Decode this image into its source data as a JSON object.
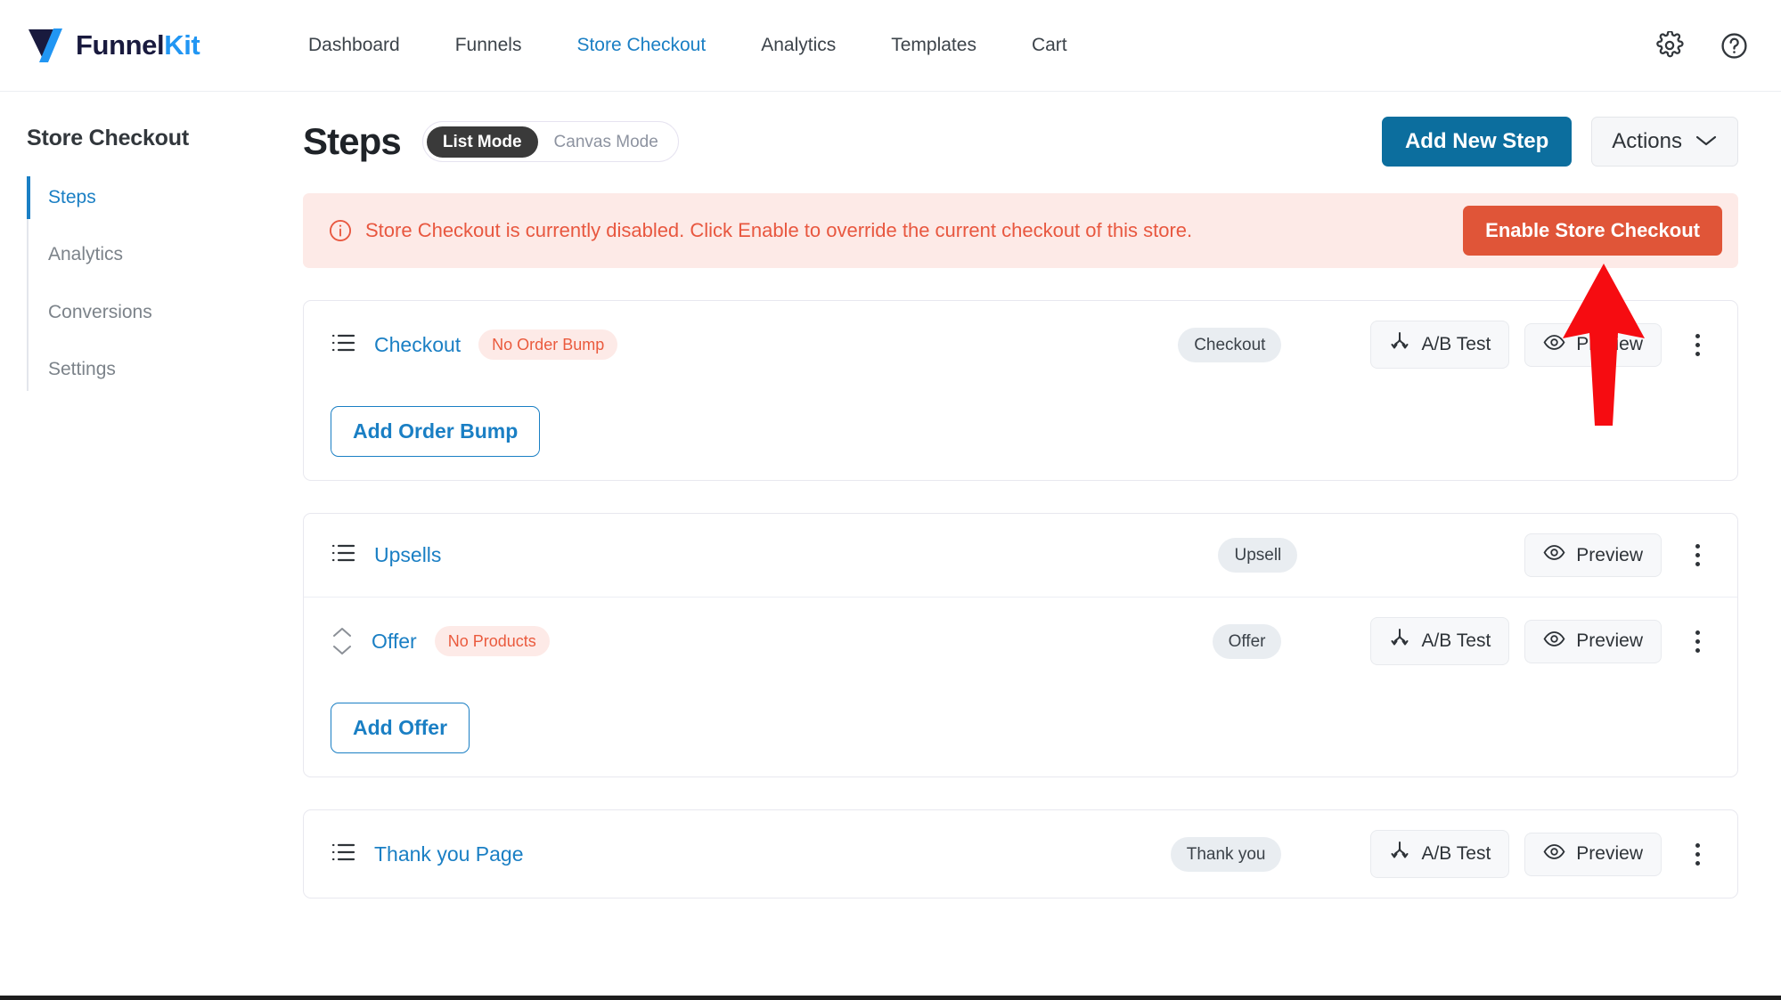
{
  "header": {
    "logo": {
      "icon": "funnelkit-logo-icon",
      "text_primary": "Funnel",
      "text_accent": "Kit"
    },
    "nav": [
      {
        "label": "Dashboard",
        "active": false
      },
      {
        "label": "Funnels",
        "active": false
      },
      {
        "label": "Store Checkout",
        "active": true
      },
      {
        "label": "Analytics",
        "active": false
      },
      {
        "label": "Templates",
        "active": false
      },
      {
        "label": "Cart",
        "active": false
      }
    ],
    "settings_icon": "gear-icon",
    "help_icon": "question-circle-icon"
  },
  "sidebar": {
    "title": "Store Checkout",
    "items": [
      {
        "label": "Steps",
        "active": true
      },
      {
        "label": "Analytics",
        "active": false
      },
      {
        "label": "Conversions",
        "active": false
      },
      {
        "label": "Settings",
        "active": false
      }
    ]
  },
  "main": {
    "page_title": "Steps",
    "mode_toggle": {
      "active": "List Mode",
      "inactive": "Canvas Mode"
    },
    "add_new_step_label": "Add New Step",
    "actions_label": "Actions",
    "notice": {
      "icon": "info-circle-icon",
      "text": "Store Checkout is currently disabled. Click Enable to override the current checkout of this store.",
      "button_label": "Enable Store Checkout"
    },
    "buttons": {
      "ab_test": "A/B Test",
      "preview": "Preview"
    },
    "cards": [
      {
        "rows": [
          {
            "icon": "list-icon",
            "name": "Checkout",
            "badge_warn": "No Order Bump",
            "badge_type": "Checkout",
            "has_ab_test": true,
            "has_preview": true
          }
        ],
        "footer_button": "Add Order Bump"
      },
      {
        "rows": [
          {
            "icon": "list-icon",
            "name": "Upsells",
            "badge_warn": null,
            "badge_type": "Upsell",
            "has_ab_test": false,
            "has_preview": true
          },
          {
            "icon": "sort-handle-icon",
            "name": "Offer",
            "badge_warn": "No Products",
            "badge_type": "Offer",
            "has_ab_test": true,
            "has_preview": true
          }
        ],
        "footer_button": "Add Offer"
      },
      {
        "rows": [
          {
            "icon": "list-icon",
            "name": "Thank you Page",
            "badge_warn": null,
            "badge_type": "Thank you",
            "has_ab_test": true,
            "has_preview": true
          }
        ],
        "footer_button": null
      }
    ]
  },
  "annotation": {
    "icon": "red-up-arrow-annotation",
    "color": "#f60c11",
    "points_at": "Enable Store Checkout"
  },
  "colors": {
    "accent_blue": "#1a7fc4",
    "primary_button": "#0c6e9e",
    "danger": "#e05538",
    "notice_bg": "#fdeae7",
    "notice_text": "#e8573f",
    "logo_navy": "#191a3e",
    "logo_blue": "#2196f3"
  }
}
